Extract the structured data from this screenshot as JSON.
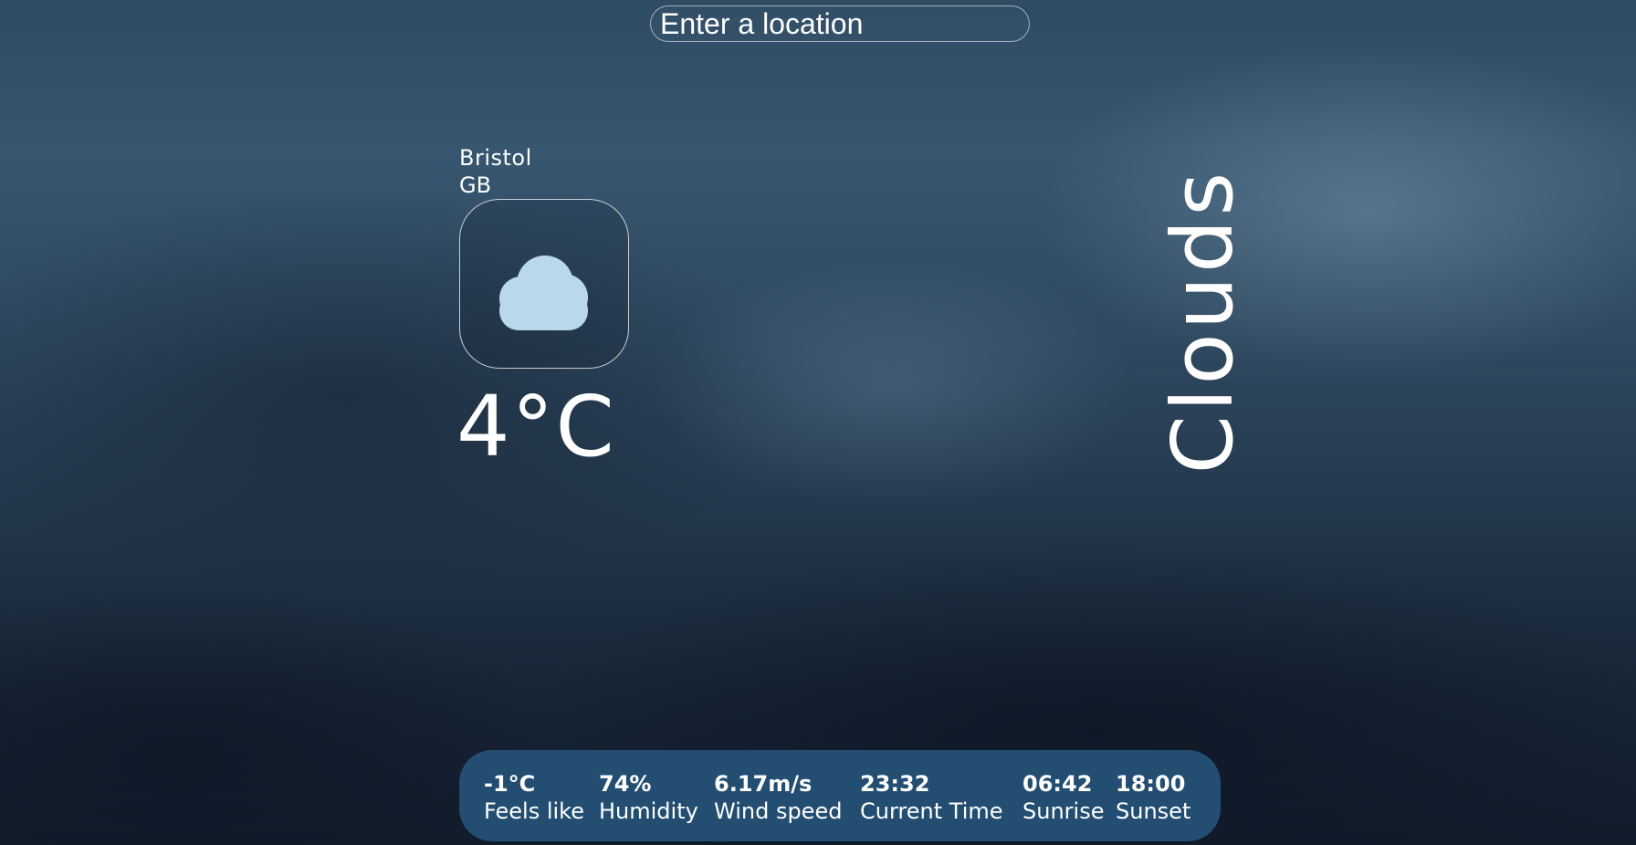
{
  "search": {
    "placeholder": "Enter a location"
  },
  "location": {
    "city": "Bristol",
    "country": "GB"
  },
  "weather": {
    "icon": "moon-cloud-icon",
    "temperature": "4°C",
    "condition": "Clouds"
  },
  "stats": [
    {
      "value": "-1°C",
      "label": "Feels like"
    },
    {
      "value": "74%",
      "label": "Humidity"
    },
    {
      "value": "6.17m/s",
      "label": "Wind speed"
    },
    {
      "value": "23:32",
      "label": "Current Time"
    },
    {
      "value": "06:42",
      "label": "Sunrise"
    },
    {
      "value": "18:00",
      "label": "Sunset"
    }
  ],
  "colors": {
    "stats_panel": "#234e72",
    "moon": "#7b6fbf",
    "cloud": "#b9d8ea",
    "text": "#ffffff"
  }
}
